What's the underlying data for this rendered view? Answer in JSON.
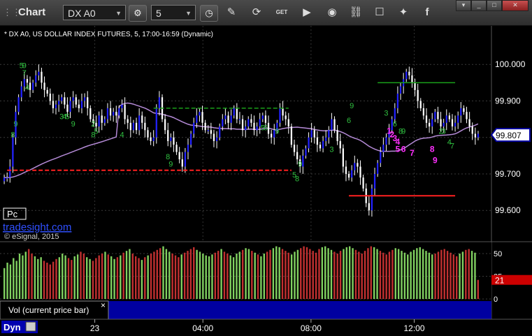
{
  "toolbar": {
    "title": "Chart",
    "symbol": "DX A0",
    "interval": "5",
    "icons": [
      "grip-icon",
      "symbol-dropdown-icon",
      "gear-icon",
      "interval-dropdown-icon",
      "clock-icon",
      "pencil-icon",
      "refresh-icon",
      "get-icon",
      "play-icon",
      "link-icon",
      "comment-icon",
      "twitter-icon",
      "facebook-icon"
    ]
  },
  "colors": {
    "up": "#2222ff",
    "down": "#ffffff",
    "ma": "#b48ad6",
    "green_line": "#1aa01a",
    "red_line": "#ff2020",
    "magenta": "#ff30ff",
    "td_green": "#30c040",
    "vol_red": "#c03030",
    "vol_green": "#80d060",
    "status_blue": "#0000a0"
  },
  "chart_data": [
    {
      "type": "candlestick",
      "title": "* DX A0, US DOLLAR INDEX FUTURES, 5, 17:00-16:59 (Dynamic)",
      "watermark": "tradesight.com",
      "copyright": "© eSignal, 2015",
      "badge": "Pc",
      "ylim": [
        99.52,
        100.1
      ],
      "yticks": [
        "100.000",
        "99.900",
        "99.800",
        "99.700",
        "99.600"
      ],
      "ytick_values": [
        100.0,
        99.9,
        99.8,
        99.7,
        99.6
      ],
      "x_labels": [
        "23",
        "04:00",
        "08:00",
        "12:00"
      ],
      "last_price": "99.807",
      "closes": [
        99.69,
        99.69,
        99.72,
        99.8,
        99.87,
        99.91,
        99.94,
        99.96,
        99.95,
        99.93,
        99.95,
        99.97,
        99.98,
        99.95,
        99.93,
        99.92,
        99.9,
        99.88,
        99.89,
        99.9,
        99.91,
        99.89,
        99.87,
        99.9,
        99.91,
        99.89,
        99.88,
        99.9,
        99.91,
        99.88,
        99.85,
        99.84,
        99.83,
        99.86,
        99.84,
        99.85,
        99.88,
        99.86,
        99.87,
        99.86,
        99.88,
        99.89,
        99.85,
        99.84,
        99.82,
        99.84,
        99.82,
        99.86,
        99.84,
        99.82,
        99.8,
        99.79,
        99.8,
        99.88,
        99.91,
        99.85,
        99.82,
        99.79,
        99.8,
        99.78,
        99.76,
        99.74,
        99.72,
        99.76,
        99.78,
        99.81,
        99.84,
        99.86,
        99.87,
        99.84,
        99.82,
        99.82,
        99.81,
        99.79,
        99.8,
        99.83,
        99.85,
        99.86,
        99.84,
        99.86,
        99.88,
        99.85,
        99.85,
        99.82,
        99.83,
        99.85,
        99.84,
        99.82,
        99.83,
        99.85,
        99.86,
        99.84,
        99.81,
        99.8,
        99.82,
        99.84,
        99.88,
        99.86,
        99.85,
        99.83,
        99.78,
        99.76,
        99.74,
        99.72,
        99.75,
        99.77,
        99.8,
        99.82,
        99.8,
        99.78,
        99.77,
        99.79,
        99.8,
        99.82,
        99.85,
        99.82,
        99.79,
        99.77,
        99.72,
        99.7,
        99.69,
        99.71,
        99.73,
        99.72,
        99.69,
        99.66,
        99.62,
        99.6,
        99.66,
        99.7,
        99.73,
        99.76,
        99.78,
        99.8,
        99.82,
        99.85,
        99.88,
        99.92,
        99.94,
        99.96,
        99.98,
        99.97,
        99.95,
        99.93,
        99.9,
        99.88,
        99.86,
        99.84,
        99.83,
        99.85,
        99.87,
        99.85,
        99.83,
        99.84,
        99.86,
        99.85,
        99.83,
        99.84,
        99.86,
        99.88,
        99.87,
        99.85,
        99.83,
        99.81,
        99.8,
        99.81
      ],
      "overlays": {
        "green_lines": [
          {
            "x0": 52,
            "x1": 99,
            "y": 99.88,
            "style": "dashed"
          },
          {
            "x0": 130,
            "x1": 157,
            "y": 99.95,
            "style": "solid"
          }
        ],
        "red_lines": [
          {
            "x0": 1,
            "x1": 100,
            "y": 99.71,
            "style": "dashed"
          },
          {
            "x0": 120,
            "x1": 157,
            "y": 99.64,
            "style": "solid"
          }
        ]
      },
      "td_counts": [
        {
          "text": "5",
          "bar": 6,
          "y": 99.99,
          "color": "green"
        },
        {
          "text": "9",
          "bar": 7,
          "y": 99.99,
          "color": "green"
        },
        {
          "text": "4",
          "bar": 8,
          "y": 99.93,
          "color": "green"
        },
        {
          "text": "9",
          "bar": 4,
          "y": 99.83,
          "color": "green"
        },
        {
          "text": "8",
          "bar": 3,
          "y": 99.8,
          "color": "green"
        },
        {
          "text": "7",
          "bar": 7,
          "y": 99.97,
          "color": "green"
        },
        {
          "text": "3",
          "bar": 20,
          "y": 99.85,
          "color": "green"
        },
        {
          "text": "4",
          "bar": 21,
          "y": 99.85,
          "color": "green"
        },
        {
          "text": "5",
          "bar": 22,
          "y": 99.85,
          "color": "green"
        },
        {
          "text": "9",
          "bar": 24,
          "y": 99.83,
          "color": "green"
        },
        {
          "text": "2",
          "bar": 31,
          "y": 99.83,
          "color": "green"
        },
        {
          "text": "5",
          "bar": 32,
          "y": 99.81,
          "color": "green"
        },
        {
          "text": "8",
          "bar": 31,
          "y": 99.8,
          "color": "green"
        },
        {
          "text": "4",
          "bar": 41,
          "y": 99.8,
          "color": "green"
        },
        {
          "text": "8",
          "bar": 57,
          "y": 99.74,
          "color": "green"
        },
        {
          "text": "9",
          "bar": 58,
          "y": 99.72,
          "color": "green"
        },
        {
          "text": "5",
          "bar": 90,
          "y": 99.82,
          "color": "green"
        },
        {
          "text": "6",
          "bar": 91,
          "y": 99.82,
          "color": "green"
        },
        {
          "text": "9",
          "bar": 95,
          "y": 99.81,
          "color": "green"
        },
        {
          "text": "5",
          "bar": 101,
          "y": 99.69,
          "color": "green"
        },
        {
          "text": "8",
          "bar": 102,
          "y": 99.68,
          "color": "green"
        },
        {
          "text": "9",
          "bar": 103,
          "y": 99.72,
          "color": "green"
        },
        {
          "text": "9",
          "bar": 121,
          "y": 99.88,
          "color": "green"
        },
        {
          "text": "6",
          "bar": 120,
          "y": 99.84,
          "color": "green"
        },
        {
          "text": "3",
          "bar": 114,
          "y": 99.76,
          "color": "green"
        },
        {
          "text": "3",
          "bar": 133,
          "y": 99.86,
          "color": "green"
        },
        {
          "text": "6",
          "bar": 136,
          "y": 99.83,
          "color": "green"
        },
        {
          "text": "8",
          "bar": 138,
          "y": 99.81,
          "color": "green"
        },
        {
          "text": "9",
          "bar": 139,
          "y": 99.81,
          "color": "green"
        },
        {
          "text": "2",
          "bar": 152,
          "y": 99.81,
          "color": "green"
        },
        {
          "text": "3",
          "bar": 153,
          "y": 99.81,
          "color": "green"
        },
        {
          "text": "4",
          "bar": 155,
          "y": 99.78,
          "color": "green"
        },
        {
          "text": "7",
          "bar": 156,
          "y": 99.77,
          "color": "green"
        },
        {
          "text": "1",
          "bar": 134,
          "y": 99.81,
          "color": "magenta"
        },
        {
          "text": "2",
          "bar": 135,
          "y": 99.8,
          "color": "magenta"
        },
        {
          "text": "3",
          "bar": 136,
          "y": 99.79,
          "color": "magenta"
        },
        {
          "text": "4",
          "bar": 137,
          "y": 99.78,
          "color": "magenta"
        },
        {
          "text": "5",
          "bar": 137,
          "y": 99.76,
          "color": "magenta"
        },
        {
          "text": "6",
          "bar": 139,
          "y": 99.76,
          "color": "magenta"
        },
        {
          "text": "7",
          "bar": 142,
          "y": 99.75,
          "color": "magenta"
        },
        {
          "text": "8",
          "bar": 149,
          "y": 99.76,
          "color": "magenta"
        },
        {
          "text": "9",
          "bar": 150,
          "y": 99.73,
          "color": "magenta"
        }
      ]
    },
    {
      "type": "bar",
      "title": "Vol (current price bar)",
      "ylim": [
        0,
        60
      ],
      "yticks": [
        "50",
        "25",
        "0"
      ],
      "ytick_values": [
        50,
        25,
        0
      ],
      "last_value": "21",
      "values": [
        34,
        40,
        38,
        45,
        42,
        50,
        48,
        52,
        55,
        50,
        47,
        44,
        46,
        42,
        40,
        38,
        41,
        44,
        46,
        50,
        48,
        45,
        43,
        47,
        49,
        52,
        50,
        46,
        44,
        42,
        45,
        48,
        50,
        52,
        49,
        47,
        44,
        46,
        48,
        51,
        53,
        55,
        50,
        47,
        45,
        43,
        46,
        48,
        50,
        52,
        54,
        56,
        58,
        55,
        52,
        50,
        48,
        46,
        49,
        51,
        53,
        55,
        57,
        54,
        52,
        50,
        48,
        47,
        49,
        51,
        53,
        55,
        52,
        50,
        48,
        46,
        50,
        52,
        54,
        56,
        55,
        53,
        51,
        49,
        47,
        50,
        52,
        54,
        56,
        58,
        57,
        55,
        53,
        51,
        49,
        52,
        54,
        56,
        58,
        57,
        55,
        53,
        51,
        55,
        57,
        58,
        56,
        54,
        52,
        50,
        53,
        55,
        57,
        58,
        56,
        54,
        52,
        50,
        53,
        56,
        58,
        57,
        55,
        53,
        51,
        49,
        52,
        54,
        56,
        55,
        53,
        51,
        49,
        52,
        54,
        56,
        57,
        55,
        53,
        51,
        49,
        50,
        52,
        54,
        55,
        53,
        51,
        49,
        47,
        50,
        52,
        54,
        55,
        53,
        51,
        21
      ]
    }
  ],
  "statusbar": {
    "dyn_label": "Dyn",
    "icon": "lock-icon",
    "close": "×"
  },
  "main": {
    "x_axis_ticks_positions": [
      0.19,
      0.41,
      0.63,
      0.84
    ]
  }
}
